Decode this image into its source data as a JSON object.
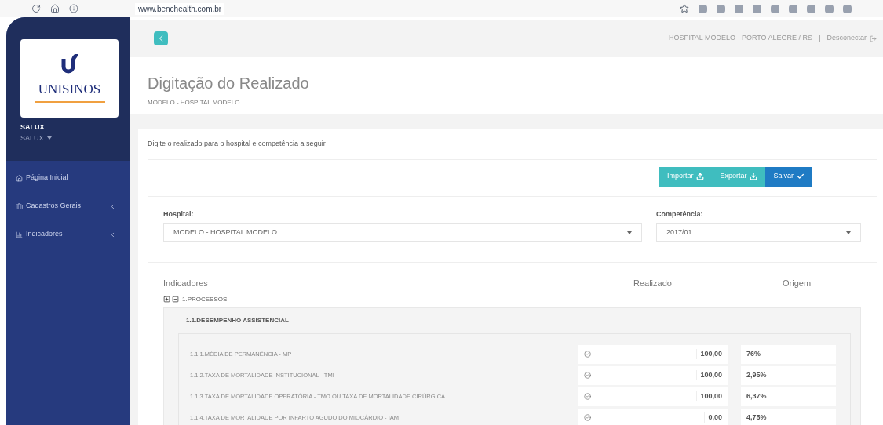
{
  "browser": {
    "url": "www.benchealth.com.br"
  },
  "sidebar": {
    "logo": "UNISINOS",
    "user": {
      "name": "SALUX",
      "role": "SALUX"
    },
    "items": [
      {
        "label": "Página Inicial",
        "kind": "home",
        "expandable": false
      },
      {
        "label": "Cadastros Gerais",
        "kind": "registry",
        "expandable": true
      },
      {
        "label": "Indicadores",
        "kind": "indicators",
        "expandable": true
      }
    ]
  },
  "topbar": {
    "location": "HOSPITAL MODELO - PORTO ALEGRE / RS",
    "separator": "|",
    "logout": "Desconectar"
  },
  "header": {
    "title": "Digitação do Realizado",
    "subtitle": "MODELO - HOSPITAL MODELO"
  },
  "instruction": "Digite o realizado para o hospital e competência a seguir",
  "actions": [
    {
      "label": "Importar",
      "kind": "upload"
    },
    {
      "label": "Exportar",
      "kind": "download"
    },
    {
      "label": "Salvar",
      "kind": "save"
    }
  ],
  "filters": [
    {
      "label": "Hospital:",
      "value": "MODELO - HOSPITAL MODELO"
    },
    {
      "label": "Competência:",
      "value": "2017/01"
    }
  ],
  "table": {
    "columns": [
      "Indicadores",
      "Realizado",
      "Origem"
    ],
    "group": "1.PROCESSOS",
    "section": "1.1.DESEMPENHO ASSISTENCIAL",
    "rows": [
      {
        "label": "1.1.1.MÉDIA DE PERMANÊNCIA - MP",
        "realizado": "100,00",
        "origem": "76%"
      },
      {
        "label": "1.1.2.TAXA DE MORTALIDADE INSTITUCIONAL - TMI",
        "realizado": "100,00",
        "origem": "2,95%"
      },
      {
        "label": "1.1.3.TAXA DE MORTALIDADE OPERATÓRIA - TMO OU TAXA DE MORTALIDADE CIRÚRGICA",
        "realizado": "100,00",
        "origem": "6,37%"
      },
      {
        "label": "1.1.4.TAXA DE MORTALIDADE POR INFARTO AGUDO DO MIOCÁRDIO - IAM",
        "realizado": "0,00",
        "origem": "4,75%"
      }
    ]
  }
}
